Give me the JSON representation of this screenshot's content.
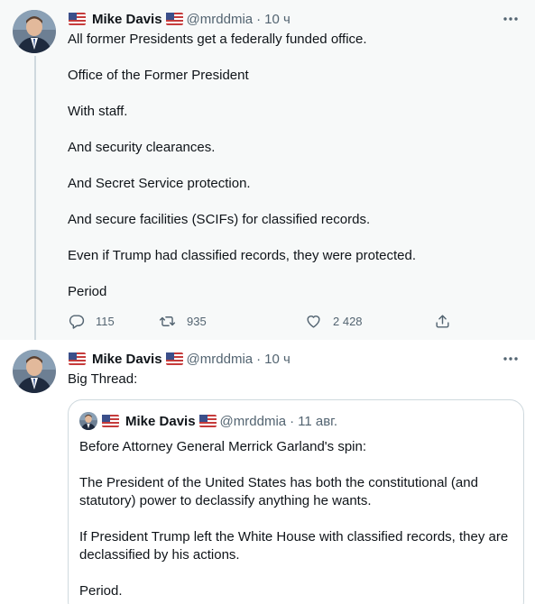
{
  "tweet1": {
    "author_name": "Mike Davis",
    "handle": "@mrddmia",
    "separator": "·",
    "time": "10 ч",
    "paragraphs": [
      "All former Presidents get a federally funded office.",
      "Office of the Former President",
      "With staff.",
      "And security clearances.",
      "And Secret Service protection.",
      "And secure facilities (SCIFs) for classified records.",
      "Even if Trump had classified records, they were protected.",
      "Period"
    ],
    "replies": "115",
    "retweets": "935",
    "likes": "2 428",
    "icons": [
      "more-icon",
      "reply-icon",
      "retweet-icon",
      "like-icon",
      "share-icon"
    ]
  },
  "tweet2": {
    "author_name": "Mike Davis",
    "handle": "@mrddmia",
    "separator": "·",
    "time": "10 ч",
    "text": "Big Thread:",
    "quote": {
      "author_name": "Mike Davis",
      "handle": "@mrddmia",
      "separator": "·",
      "time": "11 авг.",
      "paragraphs": [
        "Before Attorney General Merrick Garland's spin:",
        "The President of the United States has both the constitutional (and statutory) power to declassify anything he wants.",
        "If President Trump left the White House with classified records, they are declassified by his actions.",
        "Period."
      ]
    }
  },
  "colors": {
    "text": "#0f1419",
    "secondary": "#536471",
    "border": "#cfd9de",
    "highlight_bg": "#f7f9f9"
  }
}
